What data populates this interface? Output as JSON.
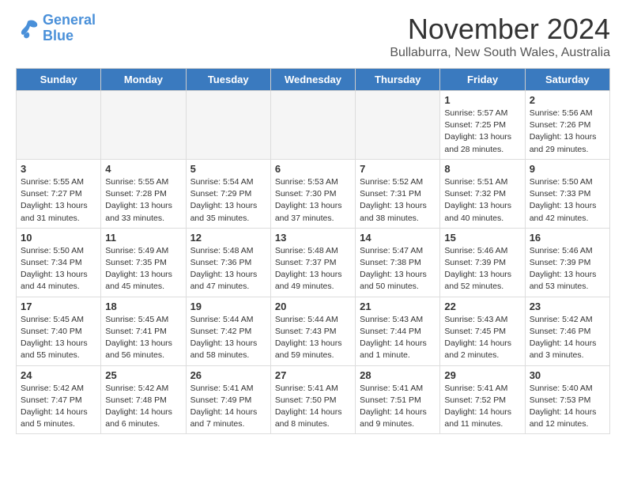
{
  "header": {
    "logo_line1": "General",
    "logo_line2": "Blue",
    "month": "November 2024",
    "location": "Bullaburra, New South Wales, Australia"
  },
  "weekdays": [
    "Sunday",
    "Monday",
    "Tuesday",
    "Wednesday",
    "Thursday",
    "Friday",
    "Saturday"
  ],
  "rows": [
    [
      {
        "day": "",
        "info": "",
        "empty": true
      },
      {
        "day": "",
        "info": "",
        "empty": true
      },
      {
        "day": "",
        "info": "",
        "empty": true
      },
      {
        "day": "",
        "info": "",
        "empty": true
      },
      {
        "day": "",
        "info": "",
        "empty": true
      },
      {
        "day": "1",
        "info": "Sunrise: 5:57 AM\nSunset: 7:25 PM\nDaylight: 13 hours\nand 28 minutes.",
        "empty": false
      },
      {
        "day": "2",
        "info": "Sunrise: 5:56 AM\nSunset: 7:26 PM\nDaylight: 13 hours\nand 29 minutes.",
        "empty": false
      }
    ],
    [
      {
        "day": "3",
        "info": "Sunrise: 5:55 AM\nSunset: 7:27 PM\nDaylight: 13 hours\nand 31 minutes.",
        "empty": false
      },
      {
        "day": "4",
        "info": "Sunrise: 5:55 AM\nSunset: 7:28 PM\nDaylight: 13 hours\nand 33 minutes.",
        "empty": false
      },
      {
        "day": "5",
        "info": "Sunrise: 5:54 AM\nSunset: 7:29 PM\nDaylight: 13 hours\nand 35 minutes.",
        "empty": false
      },
      {
        "day": "6",
        "info": "Sunrise: 5:53 AM\nSunset: 7:30 PM\nDaylight: 13 hours\nand 37 minutes.",
        "empty": false
      },
      {
        "day": "7",
        "info": "Sunrise: 5:52 AM\nSunset: 7:31 PM\nDaylight: 13 hours\nand 38 minutes.",
        "empty": false
      },
      {
        "day": "8",
        "info": "Sunrise: 5:51 AM\nSunset: 7:32 PM\nDaylight: 13 hours\nand 40 minutes.",
        "empty": false
      },
      {
        "day": "9",
        "info": "Sunrise: 5:50 AM\nSunset: 7:33 PM\nDaylight: 13 hours\nand 42 minutes.",
        "empty": false
      }
    ],
    [
      {
        "day": "10",
        "info": "Sunrise: 5:50 AM\nSunset: 7:34 PM\nDaylight: 13 hours\nand 44 minutes.",
        "empty": false
      },
      {
        "day": "11",
        "info": "Sunrise: 5:49 AM\nSunset: 7:35 PM\nDaylight: 13 hours\nand 45 minutes.",
        "empty": false
      },
      {
        "day": "12",
        "info": "Sunrise: 5:48 AM\nSunset: 7:36 PM\nDaylight: 13 hours\nand 47 minutes.",
        "empty": false
      },
      {
        "day": "13",
        "info": "Sunrise: 5:48 AM\nSunset: 7:37 PM\nDaylight: 13 hours\nand 49 minutes.",
        "empty": false
      },
      {
        "day": "14",
        "info": "Sunrise: 5:47 AM\nSunset: 7:38 PM\nDaylight: 13 hours\nand 50 minutes.",
        "empty": false
      },
      {
        "day": "15",
        "info": "Sunrise: 5:46 AM\nSunset: 7:39 PM\nDaylight: 13 hours\nand 52 minutes.",
        "empty": false
      },
      {
        "day": "16",
        "info": "Sunrise: 5:46 AM\nSunset: 7:39 PM\nDaylight: 13 hours\nand 53 minutes.",
        "empty": false
      }
    ],
    [
      {
        "day": "17",
        "info": "Sunrise: 5:45 AM\nSunset: 7:40 PM\nDaylight: 13 hours\nand 55 minutes.",
        "empty": false
      },
      {
        "day": "18",
        "info": "Sunrise: 5:45 AM\nSunset: 7:41 PM\nDaylight: 13 hours\nand 56 minutes.",
        "empty": false
      },
      {
        "day": "19",
        "info": "Sunrise: 5:44 AM\nSunset: 7:42 PM\nDaylight: 13 hours\nand 58 minutes.",
        "empty": false
      },
      {
        "day": "20",
        "info": "Sunrise: 5:44 AM\nSunset: 7:43 PM\nDaylight: 13 hours\nand 59 minutes.",
        "empty": false
      },
      {
        "day": "21",
        "info": "Sunrise: 5:43 AM\nSunset: 7:44 PM\nDaylight: 14 hours\nand 1 minute.",
        "empty": false
      },
      {
        "day": "22",
        "info": "Sunrise: 5:43 AM\nSunset: 7:45 PM\nDaylight: 14 hours\nand 2 minutes.",
        "empty": false
      },
      {
        "day": "23",
        "info": "Sunrise: 5:42 AM\nSunset: 7:46 PM\nDaylight: 14 hours\nand 3 minutes.",
        "empty": false
      }
    ],
    [
      {
        "day": "24",
        "info": "Sunrise: 5:42 AM\nSunset: 7:47 PM\nDaylight: 14 hours\nand 5 minutes.",
        "empty": false
      },
      {
        "day": "25",
        "info": "Sunrise: 5:42 AM\nSunset: 7:48 PM\nDaylight: 14 hours\nand 6 minutes.",
        "empty": false
      },
      {
        "day": "26",
        "info": "Sunrise: 5:41 AM\nSunset: 7:49 PM\nDaylight: 14 hours\nand 7 minutes.",
        "empty": false
      },
      {
        "day": "27",
        "info": "Sunrise: 5:41 AM\nSunset: 7:50 PM\nDaylight: 14 hours\nand 8 minutes.",
        "empty": false
      },
      {
        "day": "28",
        "info": "Sunrise: 5:41 AM\nSunset: 7:51 PM\nDaylight: 14 hours\nand 9 minutes.",
        "empty": false
      },
      {
        "day": "29",
        "info": "Sunrise: 5:41 AM\nSunset: 7:52 PM\nDaylight: 14 hours\nand 11 minutes.",
        "empty": false
      },
      {
        "day": "30",
        "info": "Sunrise: 5:40 AM\nSunset: 7:53 PM\nDaylight: 14 hours\nand 12 minutes.",
        "empty": false
      }
    ]
  ]
}
